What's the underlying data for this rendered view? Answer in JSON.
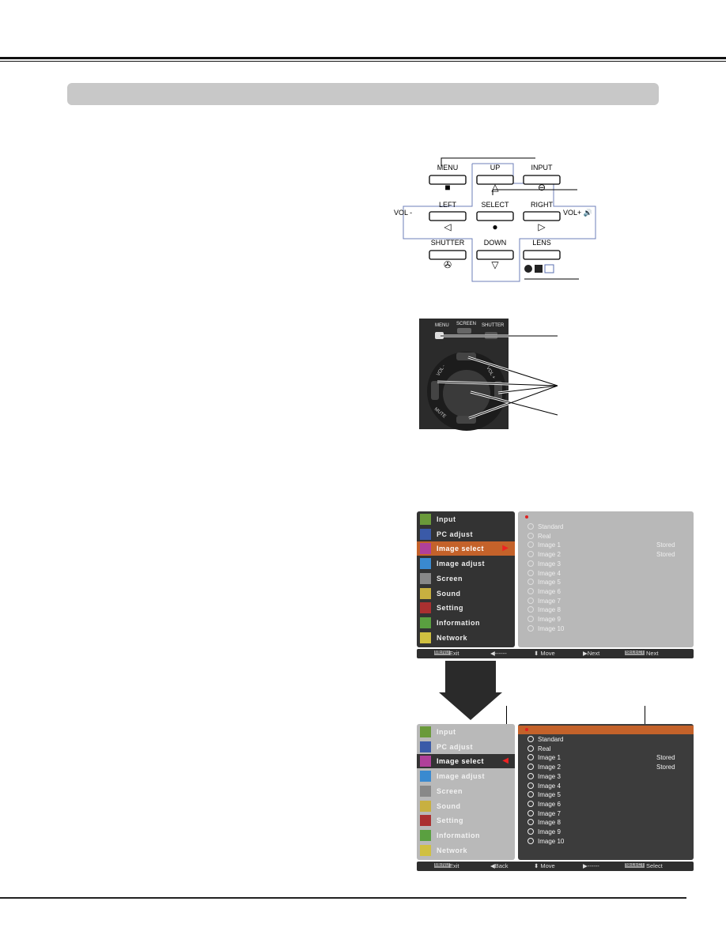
{
  "control_panel": {
    "buttons": [
      {
        "label": "MENU",
        "sub": "■"
      },
      {
        "label": "UP",
        "sub": "△"
      },
      {
        "label": "INPUT",
        "sub": "⊖"
      },
      {
        "label": "LEFT",
        "sub": "◁"
      },
      {
        "label": "SELECT",
        "sub": "●"
      },
      {
        "label": "RIGHT",
        "sub": "▷"
      },
      {
        "label": "SHUTTER",
        "sub": "✇"
      },
      {
        "label": "DOWN",
        "sub": "▽"
      },
      {
        "label": "LENS",
        "sub": ""
      }
    ],
    "vol_minus": "VOL -",
    "vol_plus": "VOL+ 🔊"
  },
  "remote": {
    "labels": {
      "menu": "MENU",
      "screen": "SCREEN",
      "shutter": "SHUTTER",
      "vol_minus": "VOL -",
      "vol_plus": "VOL +",
      "mute": "MUTE"
    }
  },
  "menu_items": [
    "Input",
    "PC adjust",
    "Image select",
    "Image adjust",
    "Screen",
    "Sound",
    "Setting",
    "Information",
    "Network"
  ],
  "image_options": [
    "Standard",
    "Real",
    "Image 1",
    "Image 2",
    "Image 3",
    "Image 4",
    "Image 5",
    "Image 6",
    "Image 7",
    "Image 8",
    "Image 9",
    "Image 10"
  ],
  "stored_label": "Stored",
  "menu1": {
    "footer": {
      "exit_key": "MENU",
      "exit": "Exit",
      "back": "◀------",
      "move": "⬍ Move",
      "next": "▶Next",
      "select_key": "SELECT",
      "select": "Next"
    }
  },
  "menu2": {
    "footer": {
      "exit_key": "MENU",
      "exit": "Exit",
      "back": "◀Back",
      "move": "⬍ Move",
      "next": "▶------",
      "select_key": "SELECT",
      "select": "Select"
    }
  },
  "colors": {
    "highlight": "#c4622a",
    "panel_blue": "#5a6fb0",
    "red_dot": "#e02020"
  }
}
